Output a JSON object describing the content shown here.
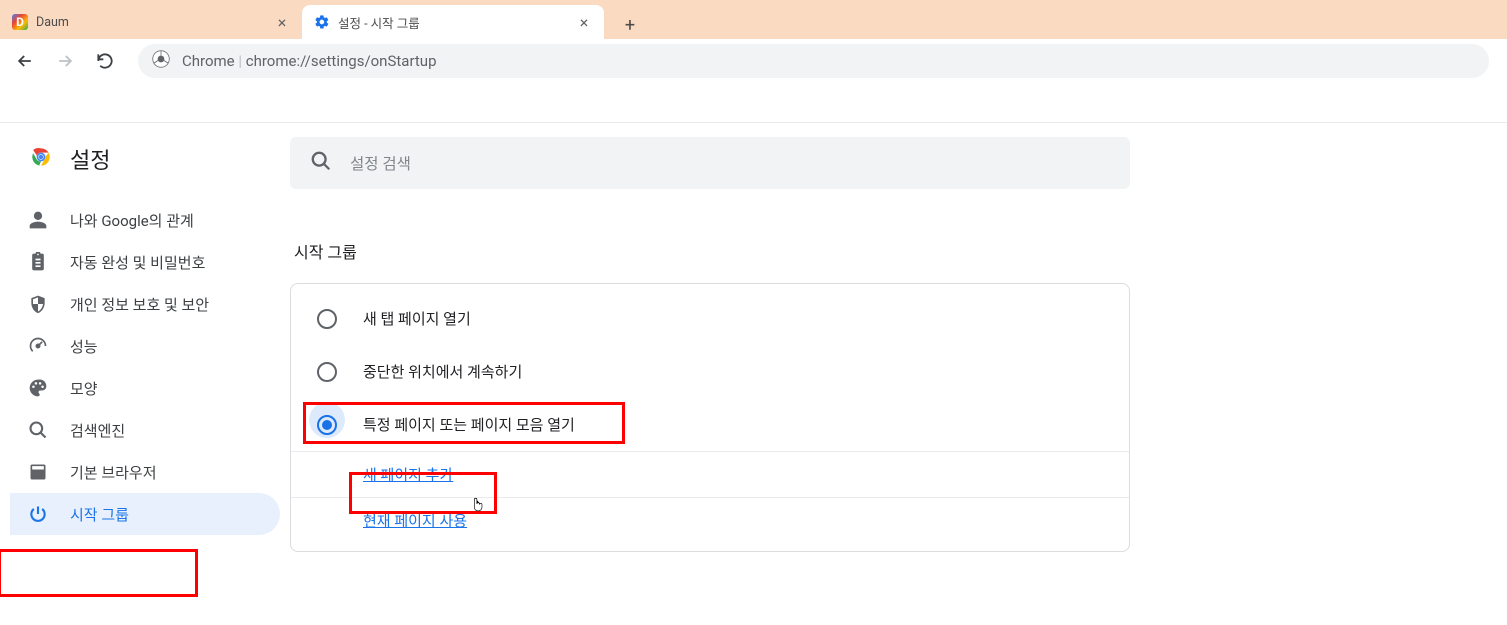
{
  "tabs": [
    {
      "title": "Daum",
      "active": false
    },
    {
      "title": "설정 - 시작 그룹",
      "active": true
    }
  ],
  "omnibox": {
    "label": "Chrome",
    "url": "chrome://settings/onStartup"
  },
  "sidebar": {
    "title": "설정",
    "items": [
      {
        "id": "people",
        "label": "나와 Google의 관계"
      },
      {
        "id": "autofill",
        "label": "자동 완성 및 비밀번호"
      },
      {
        "id": "privacy",
        "label": "개인 정보 보호 및 보안"
      },
      {
        "id": "performance",
        "label": "성능"
      },
      {
        "id": "appearance",
        "label": "모양"
      },
      {
        "id": "search",
        "label": "검색엔진"
      },
      {
        "id": "defaultbrowser",
        "label": "기본 브라우저"
      },
      {
        "id": "onstartup",
        "label": "시작 그룹"
      }
    ]
  },
  "search": {
    "placeholder": "설정 검색"
  },
  "section": {
    "title": "시작 그룹",
    "options": [
      {
        "label": "새 탭 페이지 열기",
        "checked": false
      },
      {
        "label": "중단한 위치에서 계속하기",
        "checked": false
      },
      {
        "label": "특정 페이지 또는 페이지 모음 열기",
        "checked": true
      }
    ],
    "addPage": "새 페이지 추가",
    "useCurrent": "현재 페이지 사용"
  },
  "highlights": {
    "nav": true,
    "radio3": true,
    "addpage": true
  }
}
